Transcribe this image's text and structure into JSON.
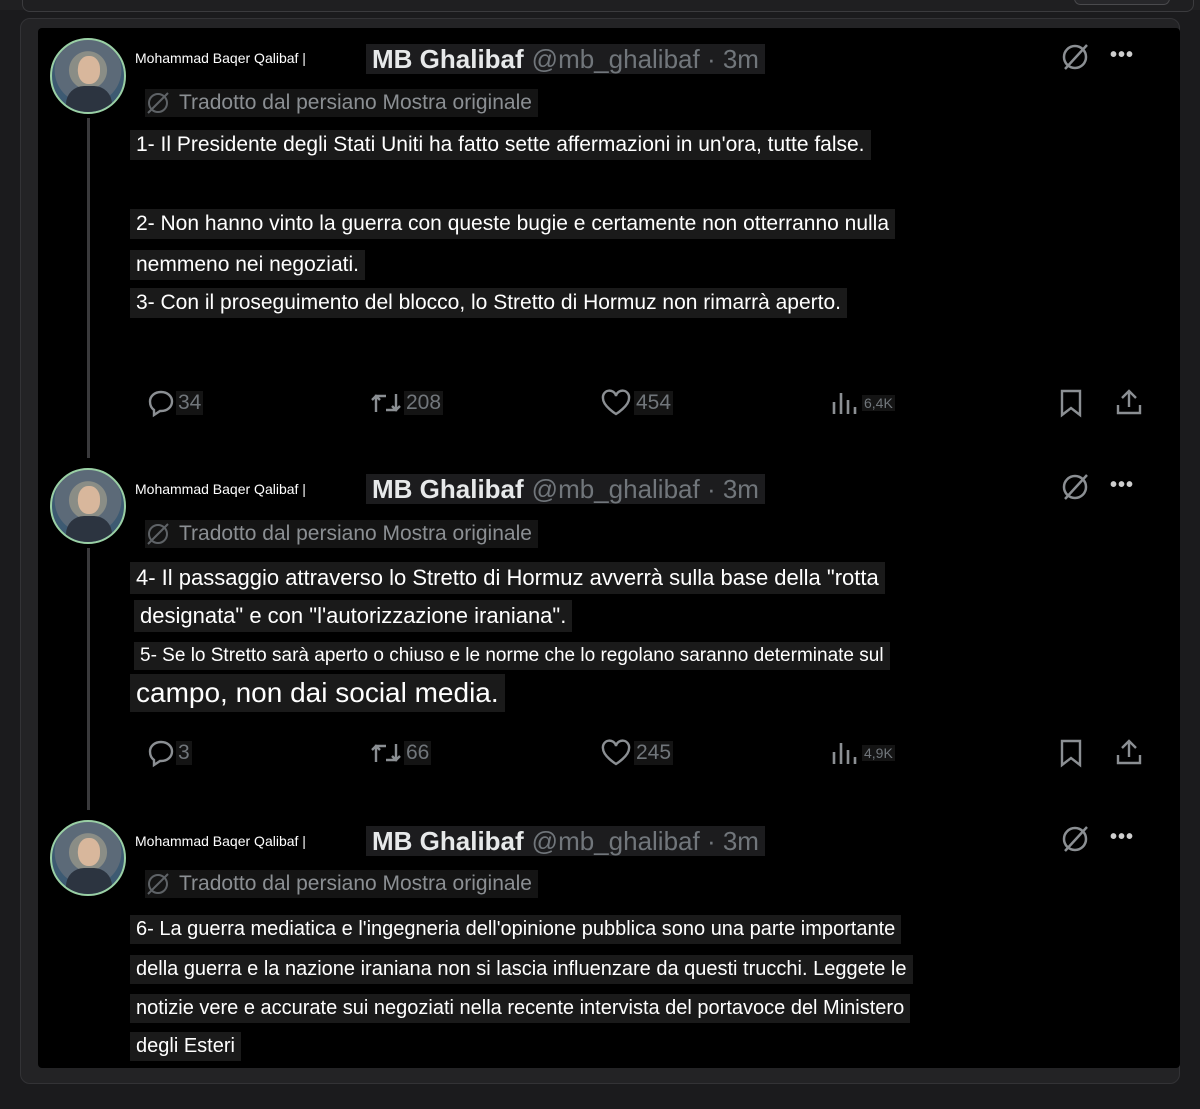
{
  "tweets": [
    {
      "author_prefix": "Mohammad Baqer Qalibaf |",
      "display_name": "MB Ghalibaf",
      "handle": "@mb_ghalibaf · 3m",
      "translated_note": "Tradotto dal persiano Mostra originale",
      "lines": [
        "1- Il Presidente degli Stati Uniti ha fatto sette affermazioni in un'ora, tutte false.",
        "2- Non hanno vinto la guerra con queste bugie e certamente non otterranno nulla",
        "nemmeno nei negoziati.",
        "3- Con il proseguimento del blocco, lo Stretto di Hormuz non rimarrà aperto."
      ],
      "stats": {
        "replies": "34",
        "reposts": "208",
        "likes": "454",
        "views": "6,4K"
      }
    },
    {
      "author_prefix": "Mohammad Baqer Qalibaf |",
      "display_name": "MB Ghalibaf",
      "handle": "@mb_ghalibaf · 3m",
      "translated_note": "Tradotto dal persiano Mostra originale",
      "lines": [
        "4- Il passaggio attraverso lo Stretto di Hormuz avverrà sulla base della \"rotta",
        "designata\" e con \"l'autorizzazione iraniana\".",
        "5- Se lo Stretto sarà aperto o chiuso e le norme che lo regolano saranno determinate sul",
        "campo, non dai social media."
      ],
      "stats": {
        "replies": "3",
        "reposts": "66",
        "likes": "245",
        "views": "4,9K"
      }
    },
    {
      "author_prefix": "Mohammad Baqer Qalibaf |",
      "display_name": "MB Ghalibaf",
      "handle": "@mb_ghalibaf · 3m",
      "translated_note": "Tradotto dal persiano Mostra originale",
      "lines": [
        "6- La guerra mediatica e l'ingegneria dell'opinione pubblica sono una parte importante",
        "della guerra e la nazione iraniana non si lascia influenzare da questi trucchi. Leggete le",
        "notizie vere e accurate sui negoziati nella recente intervista del portavoce del Ministero",
        "degli Esteri"
      ]
    }
  ],
  "icons": {
    "reply": "speech-bubble-icon",
    "repost": "repost-arrows-icon",
    "like": "heart-icon",
    "views": "bar-chart-icon",
    "bookmark": "bookmark-icon",
    "share": "share-upload-icon",
    "grok": "grok-slash-circle-icon",
    "more": "more-dots-icon"
  },
  "colors": {
    "background": "#000000",
    "text": "#e7e9ea",
    "muted": "#71767b"
  }
}
